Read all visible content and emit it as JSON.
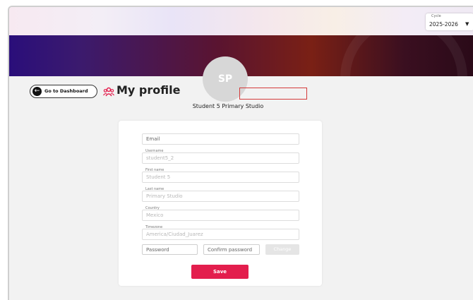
{
  "header": {
    "cycle_label": "Cycle",
    "cycle_value": "2025-2026",
    "cycle_arrow": "▼"
  },
  "nav": {
    "dashboard_label": "Go to Dashboard",
    "dashboard_icon": "arrow-left-icon"
  },
  "page": {
    "title": "My profile",
    "title_icon": "users-icon",
    "avatar_initials": "SP",
    "student_name": "Student 5 Primary Studio"
  },
  "form": {
    "email": {
      "placeholder": "Email"
    },
    "username": {
      "label": "Username",
      "value": "student5_2"
    },
    "first_name": {
      "label": "First name",
      "value": "Student 5"
    },
    "last_name": {
      "label": "Last name",
      "value": "Primary Studio"
    },
    "country": {
      "label": "Country",
      "value": "Mexico"
    },
    "timezone": {
      "label": "Timezone",
      "value": "America/Ciudad_Juarez"
    },
    "password": {
      "placeholder": "Password"
    },
    "confirm_password": {
      "placeholder": "Confirm password"
    },
    "change_label": "Change",
    "save_label": "Save"
  },
  "colors": {
    "accent": "#e31e4d",
    "highlight_box": "#d43a3a"
  }
}
